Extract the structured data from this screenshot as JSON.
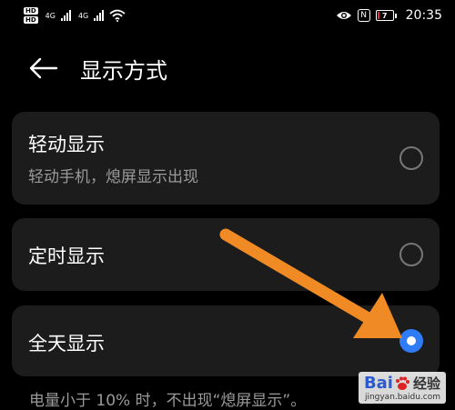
{
  "status_bar": {
    "hd1": "HD",
    "hd2": "HD",
    "net1": "4G",
    "net2": "4G",
    "nfc": "N",
    "battery_level": "7",
    "battery_fraction": 0.07,
    "battery_color": "#e0303a",
    "time": "20:35",
    "icons": [
      "signal-icon",
      "wifi-icon",
      "eye-icon",
      "nfc-icon",
      "battery-icon"
    ]
  },
  "header": {
    "back_icon": "arrow-left-icon",
    "title": "显示方式"
  },
  "options": [
    {
      "title": "轻动显示",
      "subtitle": "轻动手机，熄屏显示出现",
      "selected": false
    },
    {
      "title": "定时显示",
      "selected": false
    },
    {
      "title": "全天显示",
      "selected": true
    }
  ],
  "footnote": "电量小于 10% 时，不出现“熄屏显示”。",
  "colors": {
    "background": "#000000",
    "card": "#1c1c1c",
    "accent": "#2f7cf6",
    "annotation_arrow": "#f08a24"
  },
  "watermark": {
    "brand_prefix": "Bai",
    "brand_suffix": "经验",
    "url": "jingyan.baidu.com"
  }
}
